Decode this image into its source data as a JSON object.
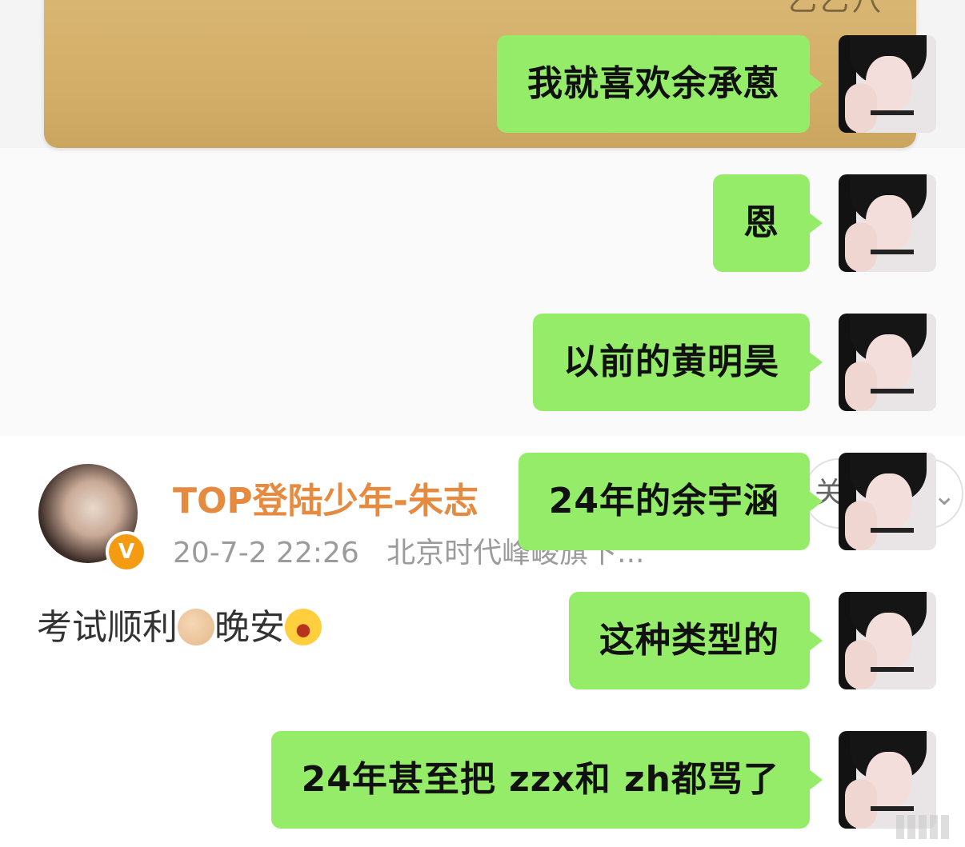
{
  "background_post": {
    "author": "TOP登陆少年-朱志",
    "timestamp": "20-7-2 22:26",
    "location": "北京时代峰峻旗下...",
    "follow_label": "关",
    "verified_badge": "V",
    "text_part1": "考试顺利",
    "text_part2": "晚安",
    "emoji1": "flexed-biceps",
    "emoji2": "yawning-face"
  },
  "top_photo_text": "乙乙八",
  "chat": {
    "bubble_color": "#95ec69",
    "messages": [
      {
        "text": "我就喜欢余承蒽",
        "sender": "self"
      },
      {
        "text": "恩",
        "sender": "self"
      },
      {
        "text": "以前的黄明昊",
        "sender": "self"
      },
      {
        "text": "24年的余宇涵",
        "sender": "self"
      },
      {
        "text": "这种类型的",
        "sender": "self"
      },
      {
        "text": "24年甚至把 zzx和 zh都骂了",
        "sender": "self"
      }
    ]
  }
}
